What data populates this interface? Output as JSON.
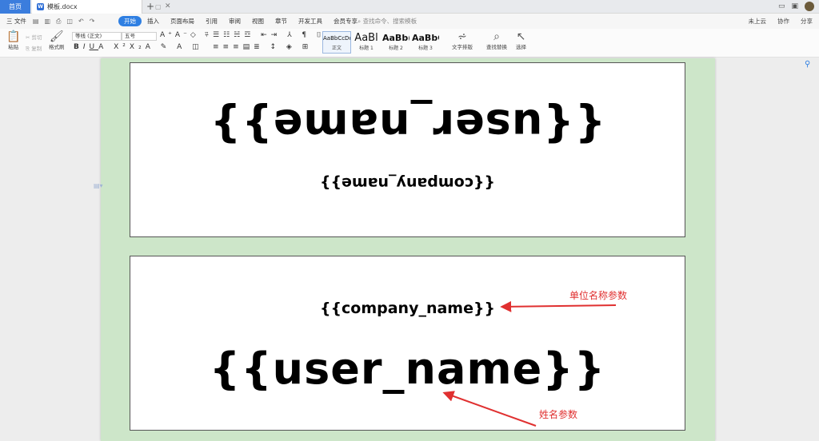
{
  "titlebar": {
    "home_tab": "首页",
    "doc_tab": "模板.docx",
    "doc_icon": "W",
    "new_tab": "+"
  },
  "menubar": {
    "file": "三 文件",
    "tabs": [
      "开始",
      "插入",
      "页面布局",
      "引用",
      "审阅",
      "视图",
      "章节",
      "开发工具",
      "会员专享"
    ],
    "search_placeholder": "查找命令、搜索模板",
    "right": [
      "未上云",
      "协作",
      "分享"
    ]
  },
  "ribbon": {
    "paste": "粘贴",
    "cut": "剪切",
    "copy": "复制",
    "format_painter": "格式刷",
    "font_name": "等线 (正文)",
    "font_size": "五号",
    "styles": [
      {
        "sample": "AaBbCcDd",
        "label": "正文"
      },
      {
        "sample": "AaBl",
        "label": "标题 1"
      },
      {
        "sample": "AaBb(",
        "label": "标题 2"
      },
      {
        "sample": "AaBbC",
        "label": "标题 3"
      }
    ],
    "text_layout": "文字排版",
    "find_replace": "查找替换",
    "select": "选择"
  },
  "document": {
    "card1_user": "{{user_name}}",
    "card1_company": "{{company_name}}",
    "card2_company": "{{company_name}}",
    "card2_user": "{{user_name}}"
  },
  "annotations": {
    "company_label": "单位名称参数",
    "user_label": "姓名参数",
    "color": "#e03030"
  }
}
